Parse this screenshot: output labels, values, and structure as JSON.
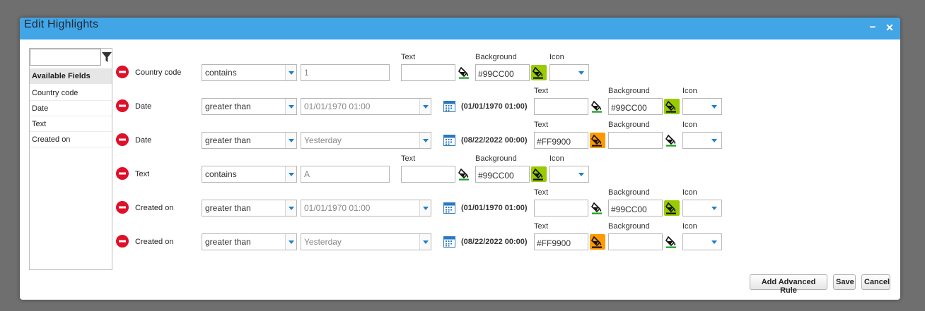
{
  "dialog": {
    "title": "Edit Highlights"
  },
  "window": {
    "minimize_glyph": "−",
    "close_glyph": "✕"
  },
  "left_panel": {
    "filter_value": "",
    "header": "Available Fields",
    "fields": [
      "Country code",
      "Date",
      "Text",
      "Created on"
    ]
  },
  "labels": {
    "text": "Text",
    "background": "Background",
    "icon": "Icon"
  },
  "rules": [
    {
      "field": "Country code",
      "operator": "contains",
      "value": "1",
      "date_note": "",
      "text_color": "",
      "background": "#99CC00",
      "accent": "#99CC00",
      "accent_on": "background"
    },
    {
      "field": "Date",
      "operator": "greater than",
      "value": "01/01/1970 01:00",
      "date_note": "(01/01/1970 01:00)",
      "text_color": "",
      "background": "#99CC00",
      "accent": "#99CC00",
      "accent_on": "background"
    },
    {
      "field": "Date",
      "operator": "greater than",
      "value": "Yesterday",
      "date_note": "(08/22/2022 00:00)",
      "text_color": "#FF9900",
      "background": "",
      "accent": "#FF9900",
      "accent_on": "text"
    },
    {
      "field": "Text",
      "operator": "contains",
      "value": "A",
      "date_note": "",
      "text_color": "",
      "background": "#99CC00",
      "accent": "#99CC00",
      "accent_on": "background"
    },
    {
      "field": "Created on",
      "operator": "greater than",
      "value": "01/01/1970 01:00",
      "date_note": "(01/01/1970 01:00)",
      "text_color": "",
      "background": "#99CC00",
      "accent": "#99CC00",
      "accent_on": "background"
    },
    {
      "field": "Created on",
      "operator": "greater than",
      "value": "Yesterday",
      "date_note": "(08/22/2022 00:00)",
      "text_color": "#FF9900",
      "background": "",
      "accent": "#FF9900",
      "accent_on": "text"
    }
  ],
  "footer": {
    "add_advanced_rule": "Add Advanced Rule",
    "save": "Save",
    "cancel": "Cancel"
  },
  "colors": {
    "titlebar": "#42A5E5",
    "remove": "#E0102A",
    "dropdown_caret": "#1E7FCB",
    "calendar": "#2B78C2"
  },
  "icons": {
    "filter": "filter-icon",
    "remove": "remove-icon",
    "dropdown": "chevron-down-icon",
    "calendar": "calendar-icon",
    "bucket": "paint-bucket-icon"
  }
}
